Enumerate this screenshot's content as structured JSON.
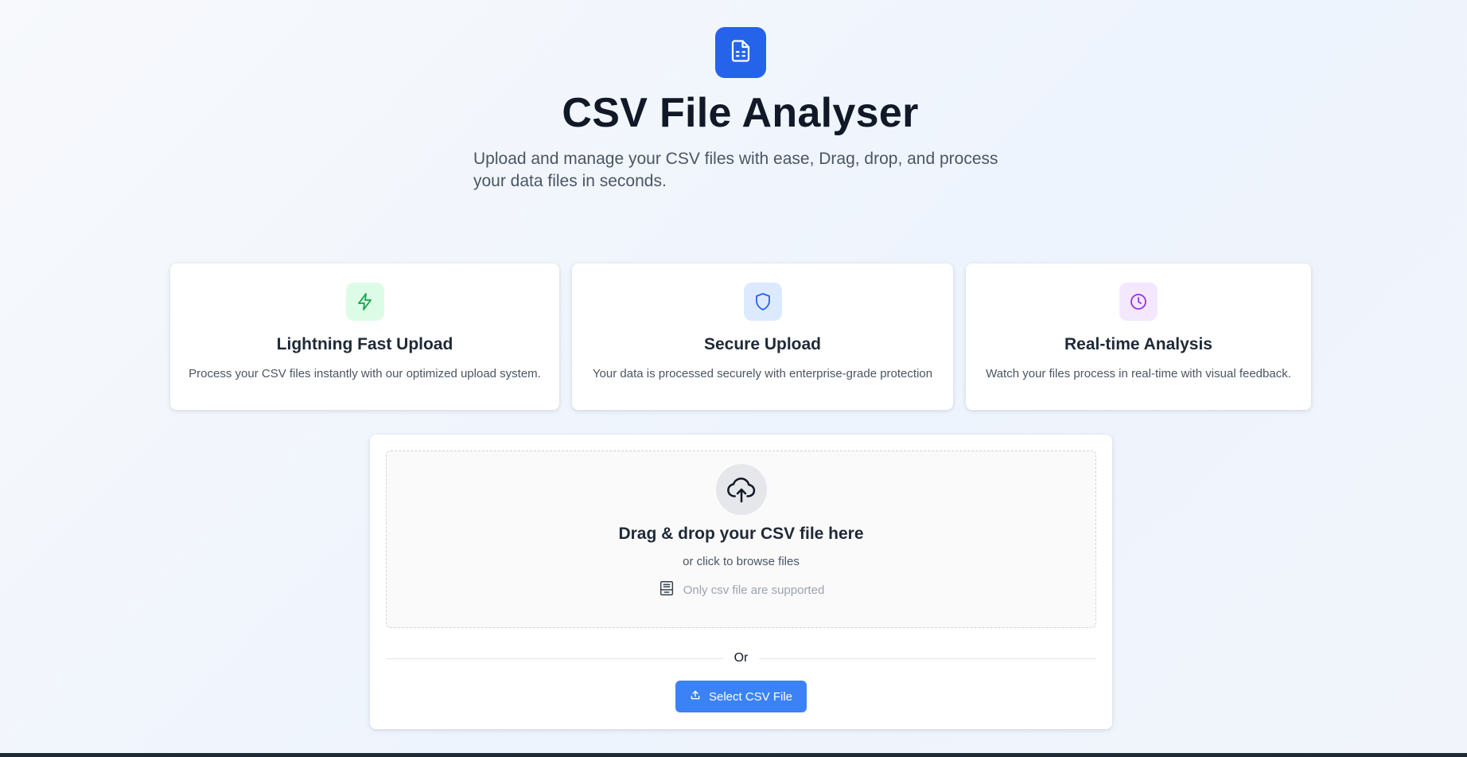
{
  "header": {
    "logo_icon": "file-spreadsheet-icon",
    "title": "CSV File Analyser",
    "subtitle": "Upload and manage your CSV files with ease, Drag, drop, and process your data files in seconds."
  },
  "features": [
    {
      "icon": "lightning-icon",
      "icon_color": "#16a34a",
      "icon_bg": "#dcfce7",
      "title": "Lightning Fast Upload",
      "description": "Process your CSV files instantly with our optimized upload system."
    },
    {
      "icon": "shield-icon",
      "icon_color": "#2563eb",
      "icon_bg": "#dbeafe",
      "title": "Secure Upload",
      "description": "Your data is processed securely with enterprise-grade protection"
    },
    {
      "icon": "clock-icon",
      "icon_color": "#9333ea",
      "icon_bg": "#f3e8ff",
      "title": "Real-time Analysis",
      "description": "Watch your files process in real-time with visual feedback."
    }
  ],
  "upload": {
    "drop_icon": "cloud-upload-icon",
    "drop_title": "Drag & drop your CSV file here",
    "drop_subtitle": "or click to browse files",
    "note_icon": "file-archive-icon",
    "note": "Only csv file are supported",
    "divider_text": "Or",
    "button_icon": "upload-icon",
    "button_label": "Select CSV File"
  },
  "colors": {
    "primary": "#2563eb",
    "button": "#3b82f6",
    "title_text": "#111827",
    "muted_text": "#4b5563"
  }
}
